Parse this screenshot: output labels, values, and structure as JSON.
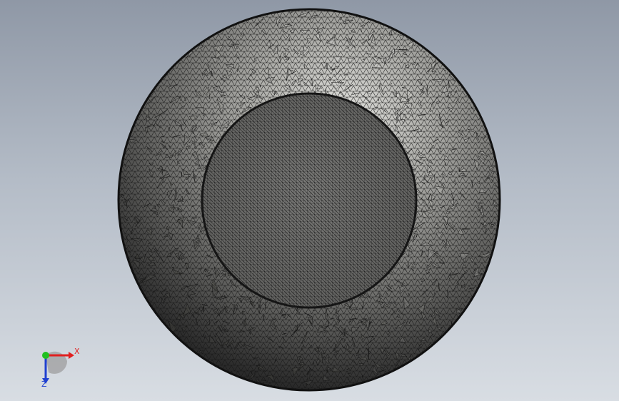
{
  "viewport": {
    "background_top": "#8f98a6",
    "background_bottom": "#d8dde3"
  },
  "model": {
    "mesh_color": "#1a1a1a",
    "surface_light": "#d4d4d0",
    "surface_dark": "#4a4a48"
  },
  "triad": {
    "x_label": "X",
    "z_label": "Z",
    "x_color": "#e02020",
    "y_color": "#20c020",
    "z_color": "#2040d0"
  }
}
